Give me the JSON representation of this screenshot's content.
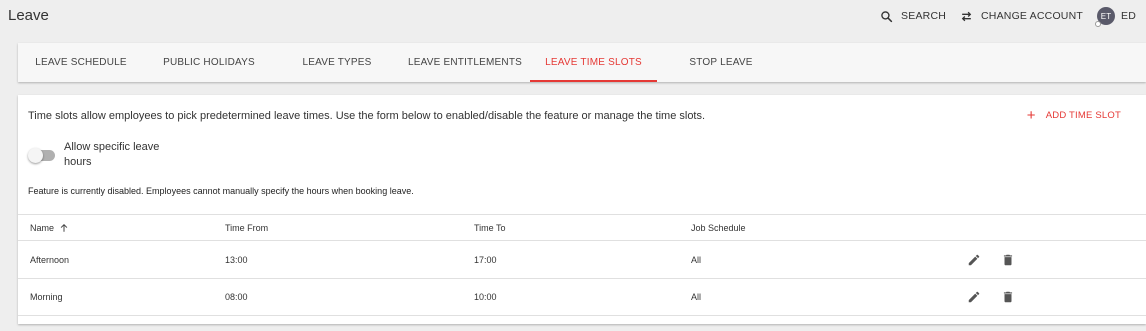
{
  "header": {
    "title": "Leave",
    "search_label": "SEARCH",
    "change_account_label": "CHANGE ACCOUNT",
    "avatar_initials": "ET",
    "user_label": "ED"
  },
  "tabs": [
    {
      "label": "LEAVE SCHEDULE",
      "active": false
    },
    {
      "label": "PUBLIC HOLIDAYS",
      "active": false
    },
    {
      "label": "LEAVE TYPES",
      "active": false
    },
    {
      "label": "LEAVE ENTITLEMENTS",
      "active": false
    },
    {
      "label": "LEAVE TIME SLOTS",
      "active": true
    },
    {
      "label": "STOP LEAVE",
      "active": false
    }
  ],
  "main": {
    "intro": "Time slots allow employees to pick predetermined leave times. Use the form below to enabled/disable the feature or manage the time slots.",
    "add_button_label": "ADD TIME SLOT",
    "toggle_label": "Allow specific leave hours",
    "toggle_on": false,
    "status": "Feature is currently disabled. Employees cannot manually specify the hours when booking leave."
  },
  "table": {
    "columns": [
      "Name",
      "Time From",
      "Time To",
      "Job Schedule"
    ],
    "rows": [
      {
        "name": "Afternoon",
        "time_from": "13:00",
        "time_to": "17:00",
        "job_schedule": "All"
      },
      {
        "name": "Morning",
        "time_from": "08:00",
        "time_to": "10:00",
        "job_schedule": "All"
      }
    ]
  },
  "colors": {
    "accent": "#e53935",
    "background": "#eeeeee",
    "card": "#ffffff"
  },
  "icons": [
    "search-icon",
    "swap-icon",
    "plus-icon",
    "arrow-up-icon",
    "pencil-icon",
    "trash-icon"
  ]
}
